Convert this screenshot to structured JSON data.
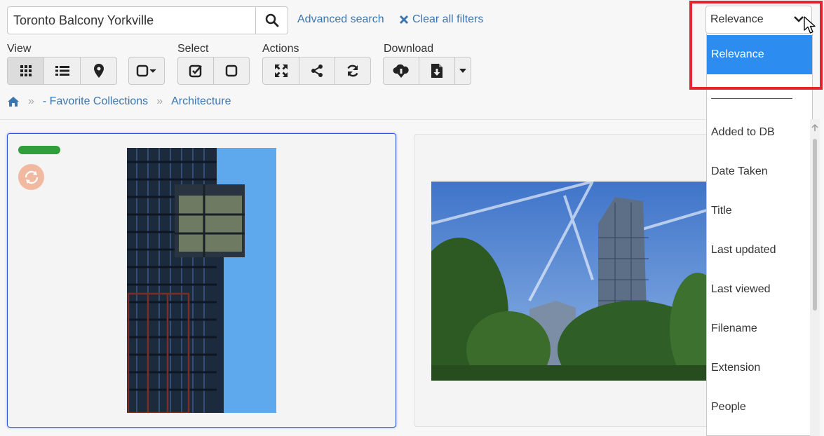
{
  "search": {
    "value": "Toronto Balcony Yorkville"
  },
  "links": {
    "advanced": "Advanced search",
    "clear": "Clear all filters"
  },
  "toolbar": {
    "view": "View",
    "select": "Select",
    "actions": "Actions",
    "download": "Download"
  },
  "breadcrumb": {
    "collections": "- Favorite Collections",
    "current": "Architecture"
  },
  "sort": {
    "selected": "Relevance",
    "options": [
      "Relevance",
      "",
      "Added to DB",
      "Date Taken",
      "Title",
      "Last updated",
      "Last viewed",
      "Filename",
      "Extension",
      "People"
    ]
  },
  "colors": {
    "accent": "#2d8cf0",
    "link": "#3a76b0",
    "highlight": "#e3262d",
    "status": "#2f9e3b"
  }
}
